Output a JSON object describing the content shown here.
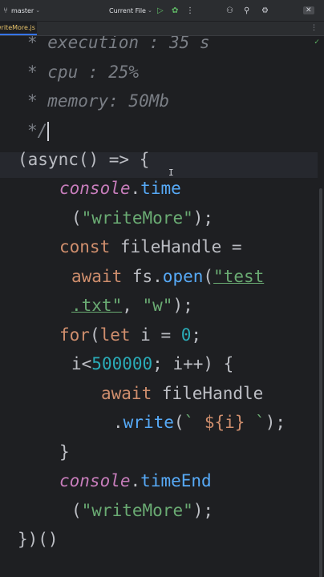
{
  "toolbar": {
    "branch": "master",
    "run_config": "Current File"
  },
  "tab": {
    "filename": "writeMore.js"
  },
  "code": {
    "l1": "* execution : 35 s",
    "l2": "* cpu : 25%",
    "l3": "* memory: 50Mb",
    "l4": "*/",
    "l5_a": "(async() => {",
    "l6_obj": "console",
    "l6_dot": ".",
    "l6_fn": "time",
    "l7_a": "(",
    "l7_str": "\"writeMore\"",
    "l7_b": ");",
    "l8_kw": "const",
    "l8_rest": " fileHandle =",
    "l9_kw": "await",
    "l9_obj": " fs.",
    "l9_fn": "open",
    "l9_p": "(",
    "l9_str": "\"test",
    "l10_str": ".txt\"",
    "l10_mid": ", ",
    "l10_str2": "\"w\"",
    "l10_end": ");",
    "l11_kw": "for",
    "l11_a": "(",
    "l11_kw2": "let",
    "l11_b": " i = ",
    "l11_num": "0",
    "l11_c": ";",
    "l12_a": "i<",
    "l12_num": "500000",
    "l12_b": "; i++) {",
    "l13_kw": "await",
    "l13_rest": " fileHandle",
    "l14_dot": ".",
    "l14_fn": "write",
    "l14_a": "(",
    "l14_str1": "` ",
    "l14_interp": "${i}",
    "l14_str2": " `",
    "l14_b": ");",
    "l15": "}",
    "l16_obj": "console",
    "l16_dot": ".",
    "l16_fn": "timeEnd",
    "l17_a": "(",
    "l17_str": "\"writeMore\"",
    "l17_b": ");",
    "l18": "})()"
  }
}
